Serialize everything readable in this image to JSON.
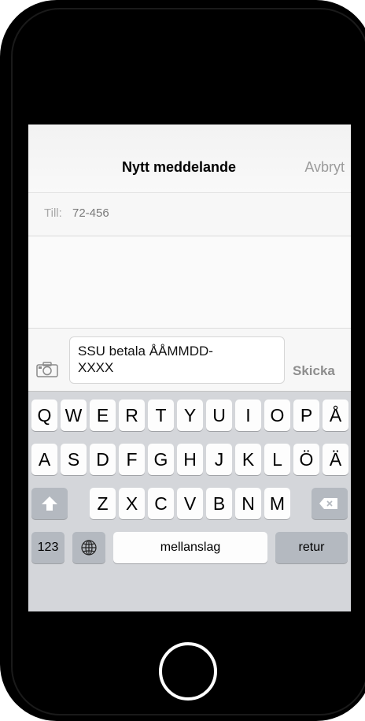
{
  "nav": {
    "title": "Nytt meddelande",
    "cancel_label": "Avbryt"
  },
  "recipient": {
    "label": "Till:",
    "value": "72-456"
  },
  "compose": {
    "message_line1": "SSU betala ÅÅMMDD-",
    "message_line2": "XXXX",
    "send_label": "Skicka"
  },
  "keyboard": {
    "row1": [
      "Q",
      "W",
      "E",
      "R",
      "T",
      "Y",
      "U",
      "I",
      "O",
      "P",
      "Å"
    ],
    "row2": [
      "A",
      "S",
      "D",
      "F",
      "G",
      "H",
      "J",
      "K",
      "L",
      "Ö",
      "Ä"
    ],
    "row3": [
      "Z",
      "X",
      "C",
      "V",
      "B",
      "N",
      "M"
    ],
    "numbers_label": "123",
    "space_label": "mellanslag",
    "return_label": "retur"
  },
  "icons": {
    "camera": "camera-icon",
    "shift": "shift-arrow-icon",
    "backspace": "backspace-icon",
    "globe": "globe-icon"
  },
  "colors": {
    "frame": "#000000",
    "keyboard_bg": "#d4d6da",
    "key_bg": "#fdfdfd",
    "dim_text": "#9b9b9b"
  }
}
